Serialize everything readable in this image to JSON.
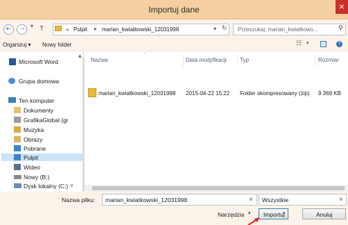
{
  "window": {
    "title": "Importuj dane",
    "close": "×"
  },
  "address": {
    "back": "←",
    "forward": "→",
    "up": "↑",
    "crumb_prefix": "«",
    "crumbs": [
      "Pulpit",
      "marian_kwiatkowski_12031998"
    ],
    "search_placeholder": "Przeszukaj: marian_kwiatkows..."
  },
  "toolbar": {
    "organize": "Organizuj ▾",
    "new_folder": "Nowy folder"
  },
  "sidebar": {
    "items": [
      {
        "label": "Microsoft Word",
        "icon": "word-icon"
      },
      {
        "label": "Grupa domowa",
        "icon": "homegroup-icon"
      },
      {
        "label": "Ten komputer",
        "icon": "computer-icon"
      },
      {
        "label": "Dokumenty",
        "icon": "documents-icon"
      },
      {
        "label": "GrafikaGlobal (gr",
        "icon": "network-folder-icon"
      },
      {
        "label": "Muzyka",
        "icon": "music-icon"
      },
      {
        "label": "Obrazy",
        "icon": "pictures-icon"
      },
      {
        "label": "Pobrane",
        "icon": "downloads-icon"
      },
      {
        "label": "Pulpit",
        "icon": "desktop-icon"
      },
      {
        "label": "Wideo",
        "icon": "video-icon"
      },
      {
        "label": "Nowy (B:)",
        "icon": "drive-icon"
      },
      {
        "label": "Dysk lokalny (C:)",
        "icon": "local-disk-icon"
      }
    ]
  },
  "columns": {
    "name": "Nazwa",
    "modified": "Data modyfikacji",
    "type": "Typ",
    "size": "Rozmiar"
  },
  "files": [
    {
      "name": "marian_kwiatkowski_12031998",
      "modified": "2015-04-22 15:22",
      "type": "Folder skompresowany (zip)",
      "size": "9 369 KB"
    }
  ],
  "bottom": {
    "filename_label": "Nazwa pliku:",
    "filename_value": "marian_kwiatkowski_12031998",
    "filter_value": "Wszystkie",
    "tools": "Narzędzia",
    "open": "Importuj",
    "cancel": "Anuluj"
  }
}
